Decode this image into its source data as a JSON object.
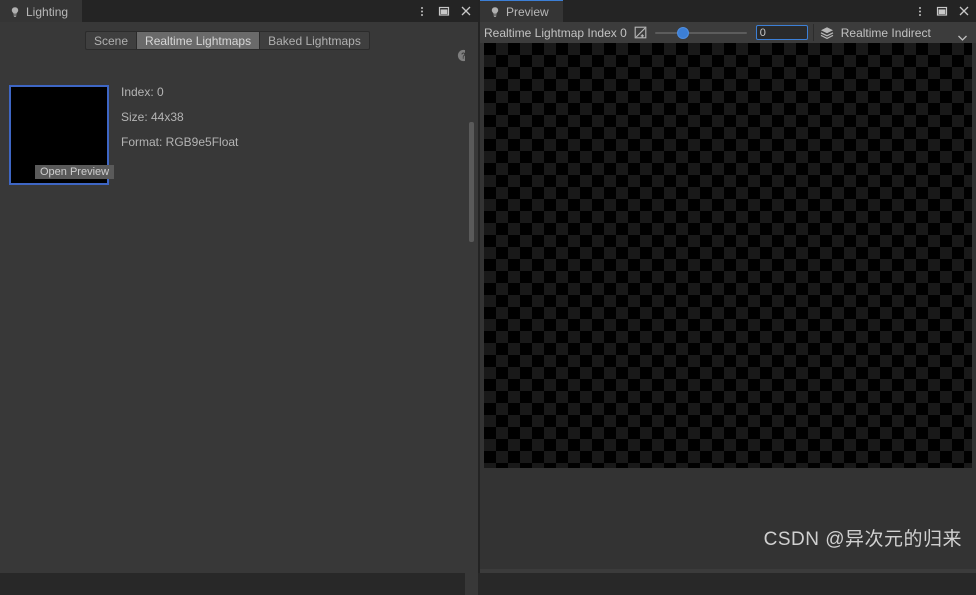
{
  "lighting_panel": {
    "tab": {
      "label": "Lighting",
      "icon": "lightbulb-icon"
    },
    "window_controls": [
      {
        "name": "more-options-icon",
        "label": "⋮"
      },
      {
        "name": "maximize-icon",
        "label": "□"
      },
      {
        "name": "close-icon",
        "label": "✕"
      }
    ],
    "modes": [
      {
        "label": "Scene",
        "selected": false
      },
      {
        "label": "Realtime Lightmaps",
        "selected": true
      },
      {
        "label": "Baked Lightmaps",
        "selected": false
      }
    ],
    "help_icon": "help-icon",
    "lightmap": {
      "open_preview_label": "Open Preview",
      "index_label": "Index: 0",
      "size_label": "Size: 44x38",
      "format_label": "Format: RGB9e5Float"
    }
  },
  "preview_panel": {
    "tab": {
      "label": "Preview",
      "icon": "lightbulb-icon"
    },
    "window_controls": [
      {
        "name": "more-options-icon",
        "label": "⋮"
      },
      {
        "name": "maximize-icon",
        "label": "□"
      },
      {
        "name": "close-icon",
        "label": "✕"
      }
    ],
    "toolbar": {
      "index_label": "Realtime Lightmap Index 0",
      "exposure_icon": "exposure-icon",
      "slider_value": 0,
      "slider_min": 0,
      "slider_max": 100,
      "numeric_value": "0",
      "layers_icon": "layers-icon",
      "channel_dropdown": "Realtime Indirect"
    }
  },
  "watermark": {
    "text": "CSDN @异次元的归来"
  },
  "colors": {
    "panel_bg": "#383838",
    "tabbar_bg": "#242424",
    "accent_blue": "#3c7fd6",
    "selection_border": "#3e66c4",
    "text": "#b4b4b4",
    "checker_dark": "#000000",
    "checker_light": "#191919"
  }
}
